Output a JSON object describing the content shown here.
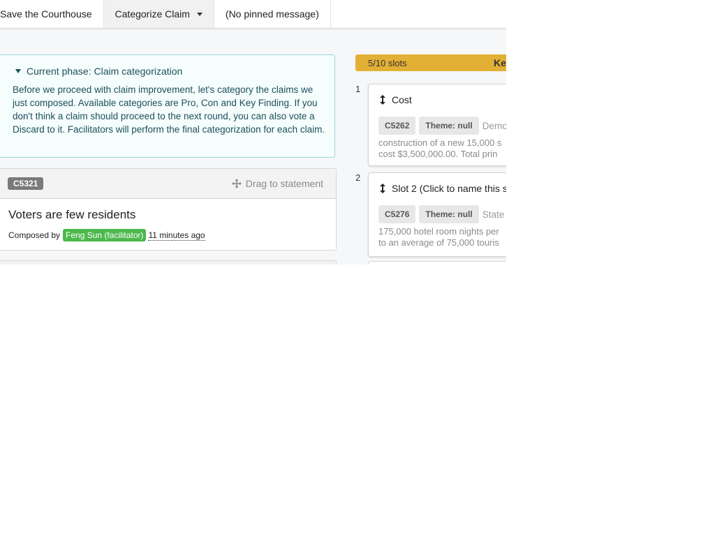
{
  "topbar": {
    "project": "Save the Courthouse",
    "menu_label": "Categorize Claim",
    "pinned": "(No pinned message)"
  },
  "phase": {
    "header": "Current phase: Claim categorization",
    "body": "Before we proceed with claim improvement, let's category the claims we just composed. Available categories are Pro, Con and Key Finding. If you don't think a claim should proceed to the next round, you can also vote a Discard to it. Facilitators will perform the final categorization for each claim."
  },
  "claim": {
    "id": "C5321",
    "drag_label": "Drag to statement",
    "title": "Voters are few residents",
    "composed_by_label": "Composed by",
    "author": "Feng Sun (facilitator)",
    "time_ago": "11 minutes ago"
  },
  "slots_panel": {
    "count": "5/10 slots",
    "title": "Ke"
  },
  "slots": [
    {
      "number": "1",
      "name": "Cost",
      "claim_id": "C5262",
      "theme": "Theme: null",
      "lead": "Demo",
      "line1": "construction of a new 15,000 s",
      "line2": "cost $3,500,000.00. Total prin"
    },
    {
      "number": "2",
      "name": "Slot 2 (Click to name this sl",
      "claim_id": "C5276",
      "theme": "Theme: null",
      "lead": "State",
      "line1": "175,000 hotel room nights per",
      "line2": "to an average of 75,000 touris"
    }
  ],
  "colors": {
    "accent_yellow": "#e2b034",
    "facilitator_green": "#4cb84c",
    "phase_bg": "#f5fdfd",
    "phase_border": "#9fd3dc"
  }
}
